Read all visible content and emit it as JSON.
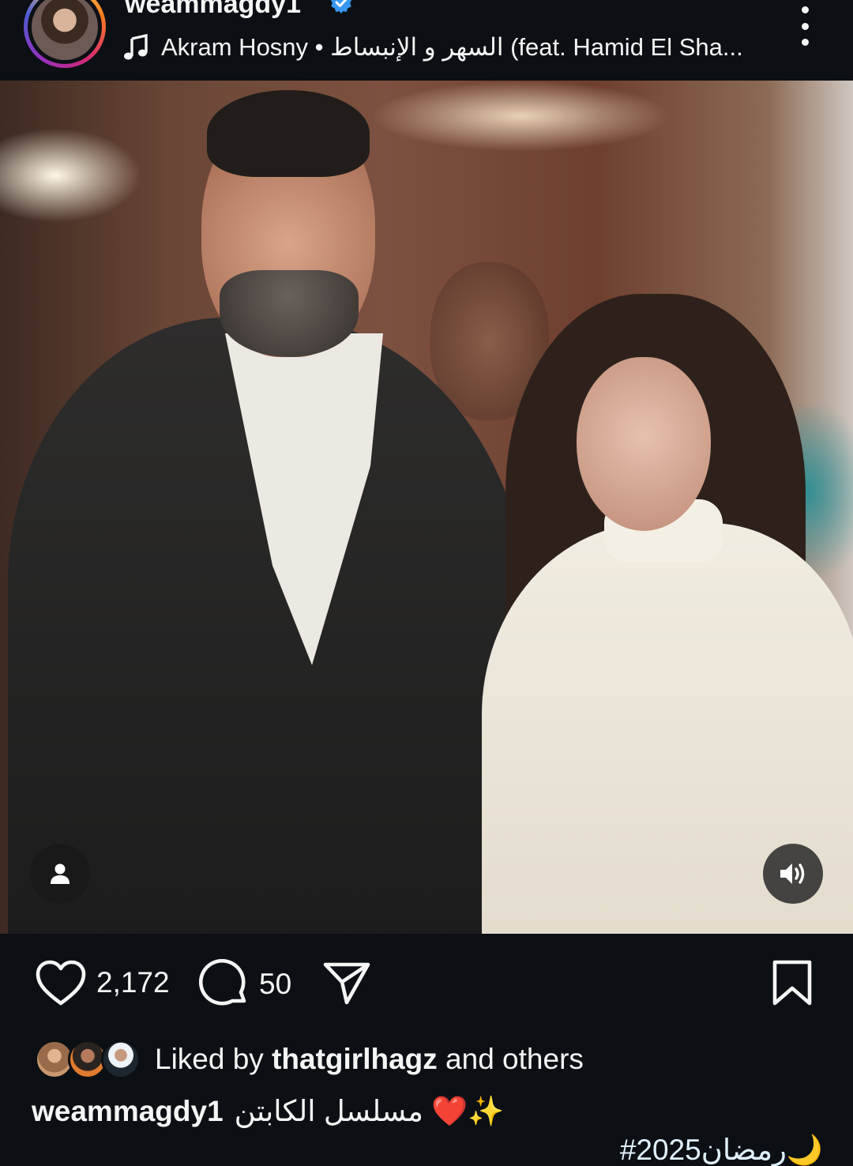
{
  "post": {
    "username": "weammagdy1",
    "verified": true,
    "verified_icon": "verified-badge-icon",
    "music": {
      "icon": "music-note-icon",
      "text": "Akram Hosny • السهر و الإنبساط (feat. Hamid El Sha..."
    },
    "more_icon": "more-vertical-icon"
  },
  "photo": {
    "tag_icon": "person-tag-icon",
    "sound_icon": "speaker-on-icon"
  },
  "actions": {
    "like_icon": "heart-icon",
    "like_count": "2,172",
    "comment_icon": "comment-bubble-icon",
    "comment_count": "50",
    "share_icon": "send-icon",
    "save_icon": "bookmark-icon"
  },
  "liked_by": {
    "prefix": "Liked by ",
    "user": "thatgirlhagz",
    "suffix": " and others"
  },
  "caption": {
    "user": "weammagdy1",
    "text": "مسلسل الكابتن ❤️✨",
    "hashtag": "#رمضان2025🌙"
  },
  "colors": {
    "background": "#0c1014",
    "text": "#f5f5f5",
    "verified": "#3897f0",
    "heart": "#e0202b"
  }
}
